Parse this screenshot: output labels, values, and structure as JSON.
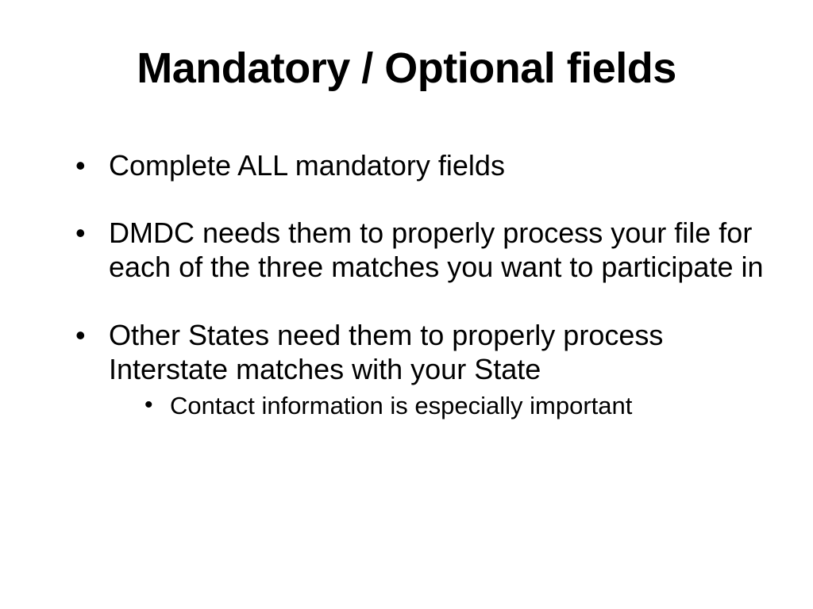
{
  "slide": {
    "title": "Mandatory / Optional fields",
    "bullets": [
      {
        "text": "Complete ALL mandatory fields"
      },
      {
        "text": "DMDC needs them to properly process your file for each of the three matches you want to participate in"
      },
      {
        "text": "Other States need them to properly process Interstate matches with your State",
        "sub": [
          "Contact information is especially important"
        ]
      }
    ]
  }
}
